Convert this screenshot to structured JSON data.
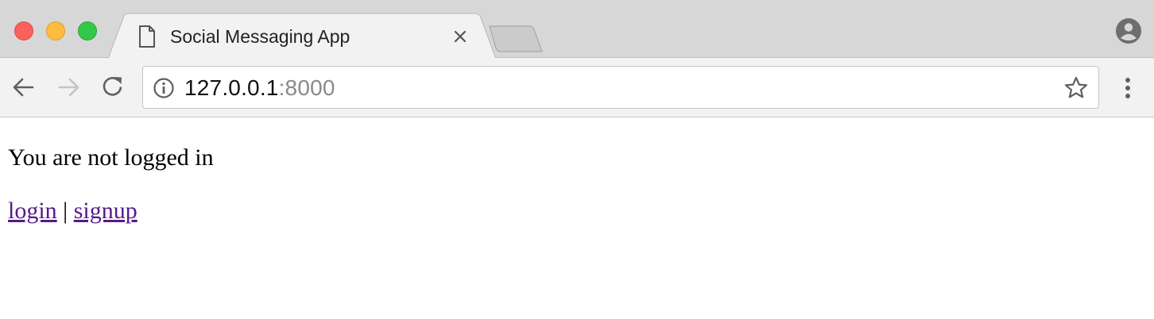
{
  "browser": {
    "tab": {
      "title": "Social Messaging App",
      "icon": "document-icon"
    },
    "address_bar": {
      "host": "127.0.0.1",
      "port_suffix": ":8000"
    }
  },
  "page": {
    "status_text": "You are not logged in",
    "links": {
      "login": "login",
      "separator": " | ",
      "signup": "signup"
    }
  },
  "colors": {
    "tabbar_bg": "#d7d7d7",
    "toolbar_bg": "#f2f2f2",
    "link_visited": "#551a8b",
    "traffic_red": "#fc605c",
    "traffic_yellow": "#fdbc40",
    "traffic_green": "#34c84a"
  }
}
